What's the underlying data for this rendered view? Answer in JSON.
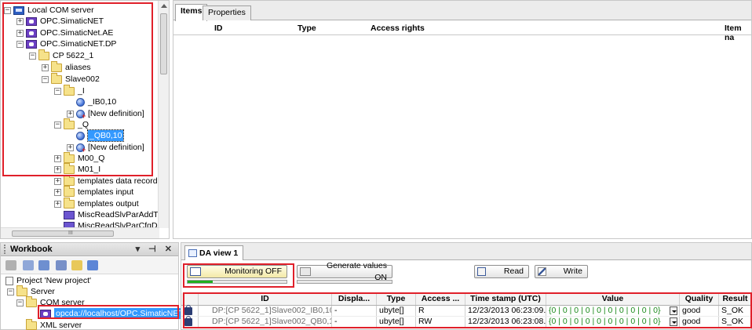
{
  "tree": {
    "items": [
      {
        "label": "Local COM server",
        "icon": "server-icon",
        "expander": "−"
      },
      {
        "label": "OPC.SimaticNET",
        "icon": "opc-server-icon",
        "expander": "+"
      },
      {
        "label": "OPC.SimaticNet.AE",
        "icon": "opc-server-icon",
        "expander": "+"
      },
      {
        "label": "OPC.SimaticNET.DP",
        "icon": "opc-server-icon",
        "expander": "−"
      },
      {
        "label": "CP 5622_1",
        "icon": "folder-icon",
        "expander": "−"
      },
      {
        "label": "aliases",
        "icon": "folder-icon",
        "expander": "+"
      },
      {
        "label": "Slave002",
        "icon": "folder-icon",
        "expander": "−"
      },
      {
        "label": "_I",
        "icon": "folder-icon",
        "expander": "−"
      },
      {
        "label": "_IB0,10",
        "icon": "item-icon",
        "expander": ""
      },
      {
        "label": "[New definition]",
        "icon": "new-definition-icon",
        "expander": "+"
      },
      {
        "label": "_Q",
        "icon": "folder-icon",
        "expander": "−"
      },
      {
        "label": "_QB0,10",
        "icon": "item-icon",
        "expander": "",
        "selected": true
      },
      {
        "label": "[New definition]",
        "icon": "new-definition-icon",
        "expander": "+"
      },
      {
        "label": "M00_Q",
        "icon": "folder-icon",
        "expander": "+"
      },
      {
        "label": "M01_I",
        "icon": "folder-icon",
        "expander": "+"
      },
      {
        "label": "templates data record",
        "icon": "folder-icon",
        "expander": "+"
      },
      {
        "label": "templates input",
        "icon": "folder-icon",
        "expander": "+"
      },
      {
        "label": "templates output",
        "icon": "folder-icon",
        "expander": "+"
      },
      {
        "label": "MiscReadSlvParAddTab",
        "icon": "table-icon",
        "expander": ""
      },
      {
        "label": "MiscReadSlvParCfgData",
        "icon": "table-icon",
        "expander": ""
      }
    ],
    "hscroll_grip": "III"
  },
  "items_panel": {
    "tabs": [
      "Items",
      "Properties"
    ],
    "active_tab": "Items",
    "columns": [
      "ID",
      "Type",
      "Access rights",
      "Item na"
    ]
  },
  "workbook": {
    "title": "Workbook",
    "controls": "▾ ⊣ ✕",
    "tree": [
      {
        "label": "Project 'New project'",
        "icon": "project-icon"
      },
      {
        "label": "Server",
        "icon": "folder-icon",
        "expander": "−"
      },
      {
        "label": "COM server",
        "icon": "folder-icon",
        "expander": "−"
      },
      {
        "label": "opcda://localhost/OPC.SimaticNET",
        "icon": "opc-server-icon",
        "selected": true
      },
      {
        "label": "XML server",
        "icon": "folder-icon",
        "expander": ""
      }
    ]
  },
  "da_view": {
    "tab_label": "DA view 1",
    "buttons": {
      "monitoring": "Monitoring OFF",
      "generate": "Generate values ON",
      "read": "Read",
      "write": "Write"
    },
    "monitoring_progress": 0.25,
    "generate_progress": 0,
    "columns": [
      "ID",
      "Displa...",
      "Type",
      "Access ...",
      "Time stamp (UTC)",
      "Value",
      "Quality",
      "Result"
    ],
    "rows": [
      {
        "id": "DP:[CP 5622_1]Slave002_IB0,10",
        "display": "-",
        "type": "ubyte[]",
        "access": "R",
        "timestamp": "12/23/2013 06:23:09.",
        "value": "{0 | 0 | 0 | 0 | 0 | 0 | 0 | 0 | 0 | 0}",
        "quality": "good",
        "result": "S_OK"
      },
      {
        "id": "DP:[CP 5622_1]Slave002_QB0,10",
        "display": "-",
        "type": "ubyte[]",
        "access": "RW",
        "timestamp": "12/23/2013 06:23:08.",
        "value": "{0 | 0 | 0 | 0 | 0 | 0 | 0 | 0 | 0 | 0}",
        "quality": "good",
        "result": "S_OK"
      }
    ]
  },
  "colors": {
    "highlight_red": "#e0202a",
    "selection_blue": "#3399ff",
    "value_green": "#1c8a1c",
    "progress_green": "#20b020"
  }
}
